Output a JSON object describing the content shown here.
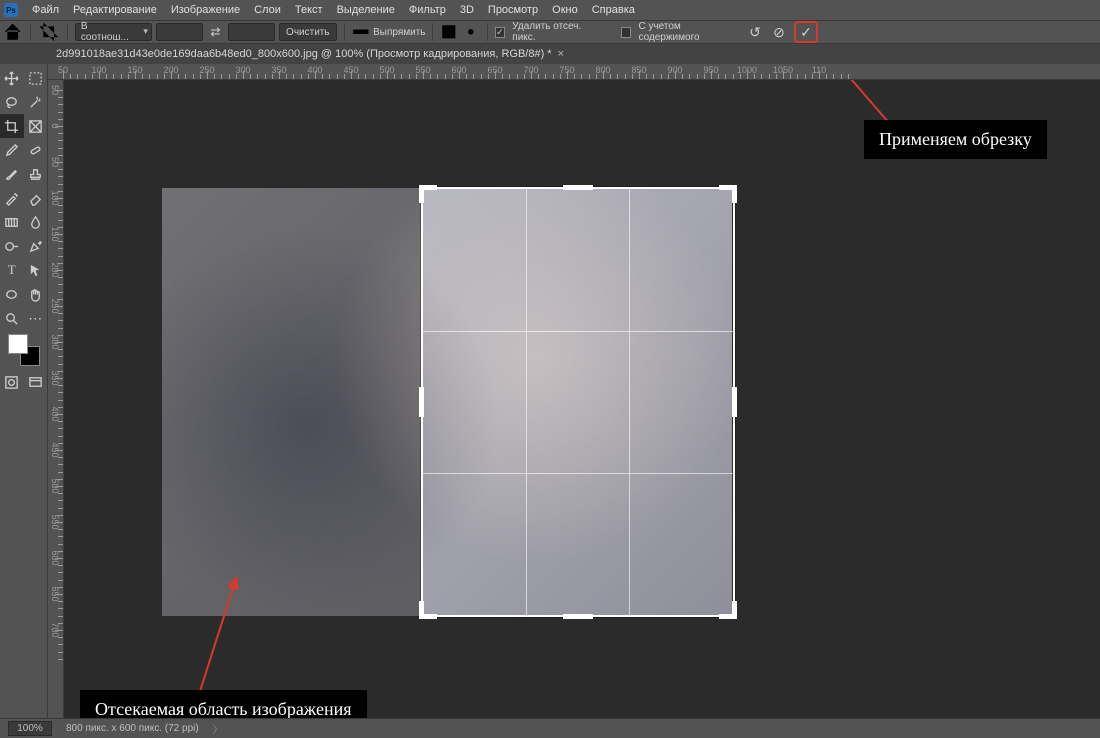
{
  "menubar": {
    "items": [
      "Файл",
      "Редактирование",
      "Изображение",
      "Слои",
      "Текст",
      "Выделение",
      "Фильтр",
      "3D",
      "Просмотр",
      "Окно",
      "Справка"
    ]
  },
  "optionsbar": {
    "ratio_dd": "В соотнош...",
    "clear_btn": "Очистить",
    "straighten_btn": "Выпрямить",
    "delete_cropped_label": "Удалить отсеч. пикс.",
    "content_aware_label": "С учетом содержимого"
  },
  "tab": {
    "title": "2d991018ae31d43e0de169daa6b48ed0_800x600.jpg @ 100% (Просмотр кадрирования, RGB/8#) *"
  },
  "ruler": {
    "h_vals": [
      "50",
      "100",
      "150",
      "200",
      "250",
      "300",
      "350",
      "400",
      "450",
      "500",
      "550",
      "600",
      "650",
      "700",
      "750",
      "800",
      "850",
      "900",
      "950",
      "1000",
      "1050",
      "110"
    ],
    "v_neg": [
      "50"
    ],
    "v_vals": [
      "0",
      "50",
      "100",
      "150",
      "200",
      "250",
      "300",
      "350",
      "400",
      "450",
      "500",
      "550",
      "600",
      "650",
      "700"
    ]
  },
  "status": {
    "zoom": "100%",
    "docinfo": "800 пикс. x 600 пикс. (72 ppi)"
  },
  "callouts": {
    "apply": "Применяем обрезку",
    "discard": "Отсекаемая область изображения"
  }
}
